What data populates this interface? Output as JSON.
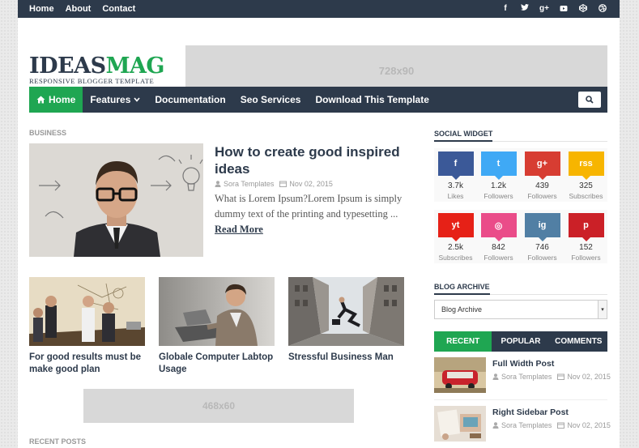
{
  "topbar": {
    "links": [
      "Home",
      "About",
      "Contact"
    ],
    "social_icons": [
      "facebook-icon",
      "twitter-icon",
      "google-plus-icon",
      "youtube-icon",
      "codepen-icon",
      "dribbble-icon"
    ]
  },
  "logo": {
    "name_a": "IDEAS",
    "name_b": "MAG",
    "tagline": "RESPONSIVE BLOGGER TEMPLATE"
  },
  "ads": {
    "top": "728x90",
    "middle": "468x60"
  },
  "nav": {
    "items": [
      {
        "label": "Home",
        "icon": "home-icon"
      },
      {
        "label": "Features",
        "icon": "chevron-down-icon"
      },
      {
        "label": "Documentation"
      },
      {
        "label": "Seo Services"
      },
      {
        "label": "Download This Template"
      }
    ]
  },
  "main": {
    "section_label": "BUSINESS",
    "featured": {
      "title": "How to create good inspired ideas",
      "author": "Sora Templates",
      "date": "Nov 02, 2015",
      "excerpt": "What is Lorem Ipsum?Lorem Ipsum is simply dummy text of the printing and typesetting ...",
      "read_more": "Read More"
    },
    "posts": [
      {
        "title": "For good results must be make good plan"
      },
      {
        "title": "Globale Computer Labtop Usage"
      },
      {
        "title": "Stressful Business Man"
      }
    ],
    "recent_label": "RECENT POSTS"
  },
  "sidebar": {
    "social_title": "SOCIAL WIDGET",
    "social": [
      {
        "count": "3.7k",
        "label": "Likes",
        "color": "#3b5998",
        "glyph": "f"
      },
      {
        "count": "1.2k",
        "label": "Followers",
        "color": "#3fa9f5",
        "glyph": "t"
      },
      {
        "count": "439",
        "label": "Followers",
        "color": "#d73d32",
        "glyph": "g+"
      },
      {
        "count": "325",
        "label": "Subscribes",
        "color": "#f7b500",
        "glyph": "rss"
      },
      {
        "count": "2.5k",
        "label": "Subscribes",
        "color": "#e62117",
        "glyph": "yt"
      },
      {
        "count": "842",
        "label": "Followers",
        "color": "#ea4c89",
        "glyph": "◎"
      },
      {
        "count": "746",
        "label": "Followers",
        "color": "#517fa4",
        "glyph": "ig"
      },
      {
        "count": "152",
        "label": "Followers",
        "color": "#cb2027",
        "glyph": "p"
      }
    ],
    "archive_title": "BLOG ARCHIVE",
    "archive_select": "Blog Archive",
    "tabs": [
      "RECENT",
      "POPULAR",
      "COMMENTS"
    ],
    "recent_posts": [
      {
        "title": "Full Width Post",
        "author": "Sora Templates",
        "date": "Nov 02, 2015"
      },
      {
        "title": "Right Sidebar Post",
        "author": "Sora Templates",
        "date": "Nov 02, 2015"
      }
    ]
  }
}
